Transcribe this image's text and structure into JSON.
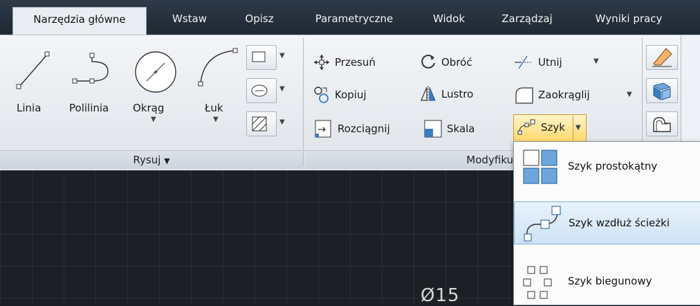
{
  "tabs": [
    "Narzędzia główne",
    "Wstaw",
    "Opisz",
    "Parametryczne",
    "Widok",
    "Zarządzaj",
    "Wyniki pracy"
  ],
  "draw": {
    "line": "Linia",
    "polyline": "Polilinia",
    "circle": "Okrąg",
    "arc": "Łuk",
    "panel_title": "Rysuj",
    "panel_arrow": "▼"
  },
  "modify": {
    "move": "Przesuń",
    "rotate": "Obróć",
    "trim": "Utnij",
    "copy": "Kopiuj",
    "mirror": "Lustro",
    "fillet": "Zaokrąglij",
    "stretch": "Rozciągnij",
    "scale": "Skala",
    "array": "Szyk",
    "panel_title": "Modyfiku"
  },
  "array_menu": {
    "items": [
      "Szyk prostokątny",
      "Szyk wzdłuż ścieżki",
      "Szyk biegunowy"
    ]
  },
  "canvas": {
    "dimension_text": "Ø15"
  },
  "colors": {
    "tabbar": "#263240",
    "ribbon": "#e9edf2",
    "canvas": "#1c1f24",
    "hover": "#cfe3f5",
    "accent_blue": "#3a7cc0"
  }
}
